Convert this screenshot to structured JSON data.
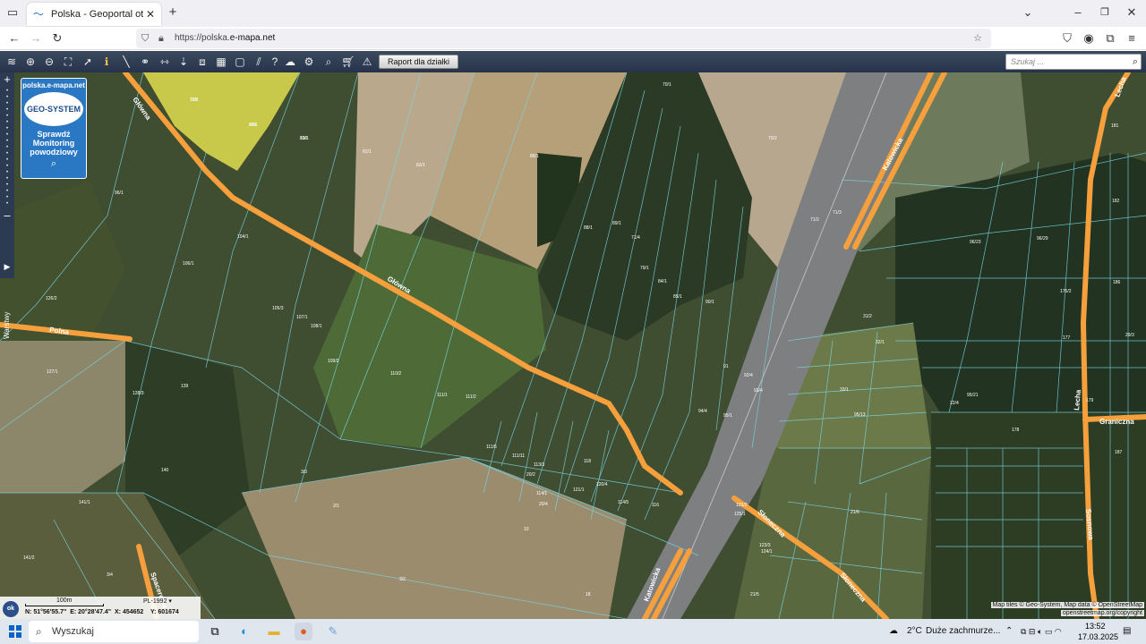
{
  "browser": {
    "tab_title": "Polska - Geoportal otwartych d…",
    "url_prefix": "https://polska.",
    "url_domain": "e-mapa.net"
  },
  "toolbar": {
    "raport_label": "Raport dla działki",
    "search_placeholder": "Szukaj ..."
  },
  "sidebar": {
    "warstwy_label": "Warstwy"
  },
  "logo": {
    "site": "polska.e-mapa.net",
    "brand": "GEO-SYSTEM",
    "line1": "Sprawdź",
    "line2": "Monitoring",
    "line3": "powodziowy"
  },
  "map": {
    "roads": [
      "Główna",
      "Główna",
      "Polna",
      "Katowicka",
      "Słoneczna",
      "Słoneczna",
      "Lecha",
      "Lecha",
      "Graniczna",
      "Sosnowa",
      "Spacerowa",
      "Katowicka"
    ],
    "parcels": [
      "78/1",
      "80/1",
      "81/1",
      "82/1",
      "83/1",
      "86/1",
      "88/1",
      "89/1",
      "70/1",
      "70/2",
      "71/2",
      "71/3",
      "71/4",
      "79/1",
      "84/1",
      "85/1",
      "90/1",
      "91",
      "92/4",
      "93/4",
      "94/4",
      "95/1",
      "96/1",
      "104/1",
      "105/3",
      "106/1",
      "107/1",
      "108/1",
      "109/2",
      "110/2",
      "111/1",
      "111/2",
      "111/5",
      "111/11",
      "113/3",
      "114/1",
      "114/5",
      "116",
      "118",
      "120/4",
      "121/1",
      "123/2",
      "123/3",
      "124/1",
      "125/1",
      "126/2",
      "127/1",
      "128/3",
      "139",
      "140",
      "141/1",
      "141/2",
      "3/4",
      "3/3",
      "2/1",
      "3/2",
      "10",
      "18",
      "20/2",
      "20/4",
      "21/5",
      "21/6",
      "22/4",
      "29/3",
      "31/2",
      "32/1",
      "33/1",
      "95/13",
      "95/21",
      "96/23",
      "96/29",
      "176/2",
      "177",
      "178",
      "179",
      "181",
      "182",
      "186",
      "187",
      "188",
      "189",
      "190"
    ]
  },
  "status": {
    "scale_label": "100m",
    "crs": "PL-1992",
    "coords": "N: 51°56'55.7\"  E: 20°28'47.4\"  X: 454652    Y: 601674",
    "ok_label": "ok"
  },
  "attribution": {
    "line1": "Map tiles © Geo-System, Map data © OpenStreetMap",
    "line2": "openstreetmap.org/copyright"
  },
  "taskbar": {
    "search_label": "Wyszukaj",
    "weather_temp": "2°C",
    "weather_text": "Duże zachmurze...",
    "time": "13:52",
    "date": "17.03.2025"
  },
  "colors": {
    "road": "#f5a03c",
    "parcel_line": "#7ad6e6",
    "toolbar": "#2f3e55"
  }
}
